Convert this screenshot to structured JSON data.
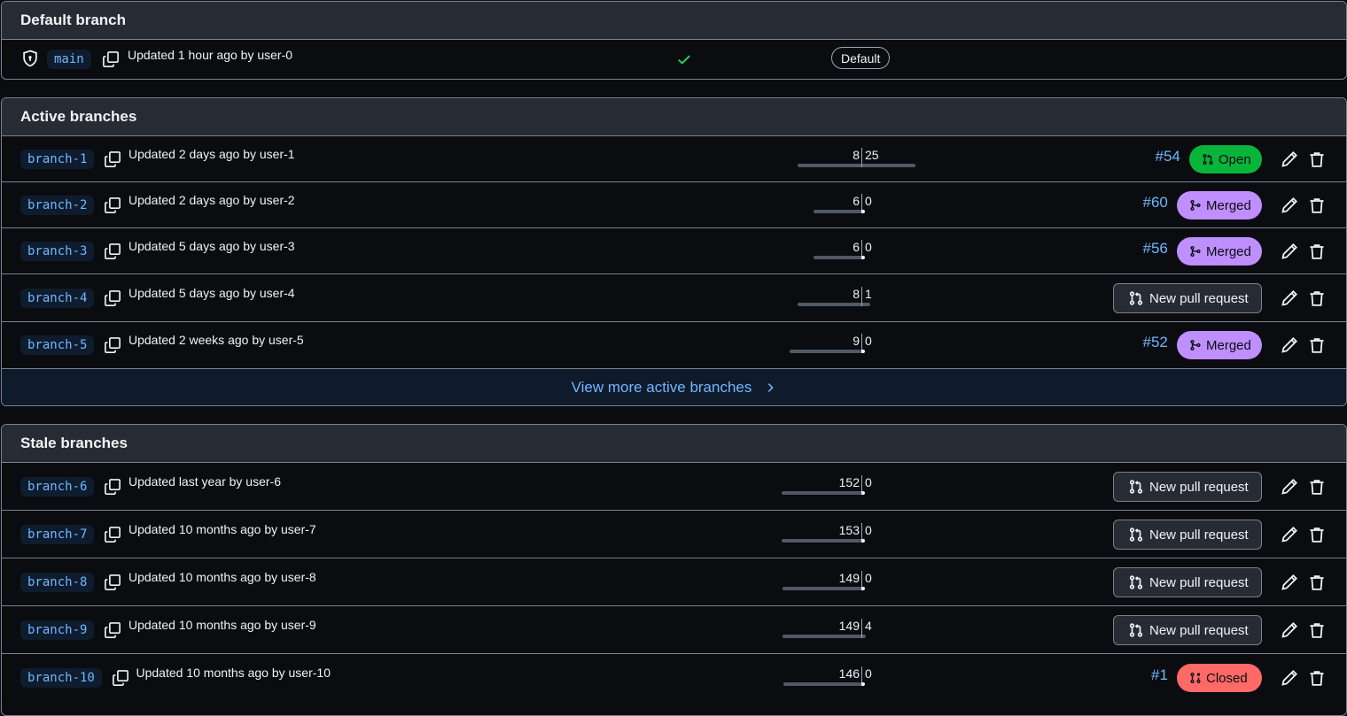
{
  "default_section": {
    "title": "Default branch",
    "branch": {
      "name": "main",
      "updated": "Updated 1 hour ago by user-0",
      "check_status": "success",
      "badge": "Default"
    }
  },
  "active_section": {
    "title": "Active branches",
    "view_more": "View more active branches",
    "branches": [
      {
        "name": "branch-1",
        "updated": "Updated 2 days ago by user-1",
        "behind": "8",
        "ahead": "25",
        "pr": {
          "number": "#54",
          "state": "Open"
        }
      },
      {
        "name": "branch-2",
        "updated": "Updated 2 days ago by user-2",
        "behind": "6",
        "ahead": "0",
        "pr": {
          "number": "#60",
          "state": "Merged"
        }
      },
      {
        "name": "branch-3",
        "updated": "Updated 5 days ago by user-3",
        "behind": "6",
        "ahead": "0",
        "pr": {
          "number": "#56",
          "state": "Merged"
        }
      },
      {
        "name": "branch-4",
        "updated": "Updated 5 days ago by user-4",
        "behind": "8",
        "ahead": "1",
        "pr": null
      },
      {
        "name": "branch-5",
        "updated": "Updated 2 weeks ago by user-5",
        "behind": "9",
        "ahead": "0",
        "pr": {
          "number": "#52",
          "state": "Merged"
        }
      }
    ]
  },
  "stale_section": {
    "title": "Stale branches",
    "branches": [
      {
        "name": "branch-6",
        "updated": "Updated last year by user-6",
        "behind": "152",
        "ahead": "0",
        "pr": null
      },
      {
        "name": "branch-7",
        "updated": "Updated 10 months ago by user-7",
        "behind": "153",
        "ahead": "0",
        "pr": null
      },
      {
        "name": "branch-8",
        "updated": "Updated 10 months ago by user-8",
        "behind": "149",
        "ahead": "0",
        "pr": null
      },
      {
        "name": "branch-9",
        "updated": "Updated 10 months ago by user-9",
        "behind": "149",
        "ahead": "4",
        "pr": null
      },
      {
        "name": "branch-10",
        "updated": "Updated 10 months ago by user-10",
        "behind": "146",
        "ahead": "0",
        "pr": {
          "number": "#1",
          "state": "Closed"
        }
      }
    ]
  },
  "labels": {
    "new_pull_request": "New pull request"
  },
  "colors": {
    "open": "#09b43a",
    "merged": "#bf8fff",
    "closed": "#ff6a69",
    "link": "#71b7ff",
    "success": "#26cd4d"
  }
}
